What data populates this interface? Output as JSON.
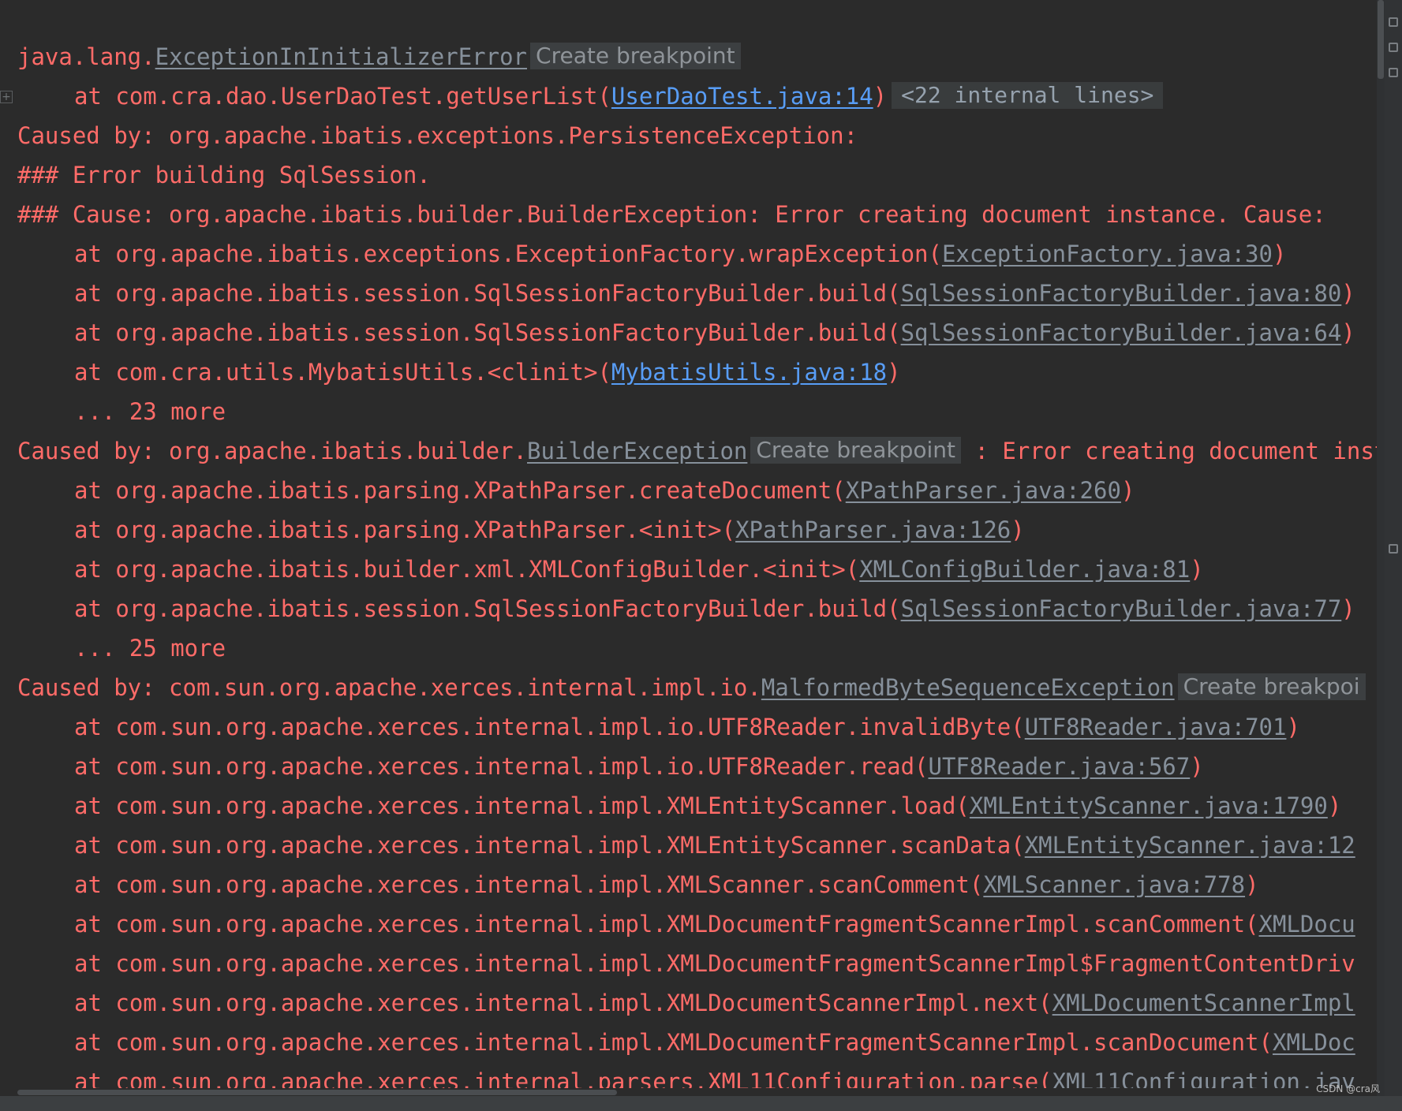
{
  "console": {
    "lines": [
      {
        "indent": false,
        "parts": [
          {
            "text": "java.lang.",
            "style": "t"
          },
          {
            "text": "ExceptionInInitializerError",
            "style": "link-gray"
          },
          {
            "text": "Create breakpoint",
            "style": "chip"
          }
        ]
      },
      {
        "indent": true,
        "parts": [
          {
            "text": "at com.cra.dao.UserDaoTest.getUserList(",
            "style": "t"
          },
          {
            "text": "UserDaoTest.java:14",
            "style": "link-blue"
          },
          {
            "text": ")",
            "style": "t"
          },
          {
            "text": "<22 internal lines>",
            "style": "chip mono"
          }
        ]
      },
      {
        "indent": false,
        "parts": [
          {
            "text": "Caused by: org.apache.ibatis.exceptions.PersistenceException:",
            "style": "t"
          }
        ]
      },
      {
        "indent": false,
        "parts": [
          {
            "text": "### Error building SqlSession.",
            "style": "t"
          }
        ]
      },
      {
        "indent": false,
        "parts": [
          {
            "text": "### Cause: org.apache.ibatis.builder.BuilderException: Error creating document instance.  Cause:",
            "style": "t"
          }
        ]
      },
      {
        "indent": true,
        "parts": [
          {
            "text": "at org.apache.ibatis.exceptions.ExceptionFactory.wrapException(",
            "style": "t"
          },
          {
            "text": "ExceptionFactory.java:30",
            "style": "link-gray"
          },
          {
            "text": ")",
            "style": "t"
          }
        ]
      },
      {
        "indent": true,
        "parts": [
          {
            "text": "at org.apache.ibatis.session.SqlSessionFactoryBuilder.build(",
            "style": "t"
          },
          {
            "text": "SqlSessionFactoryBuilder.java:80",
            "style": "link-gray"
          },
          {
            "text": ")",
            "style": "t"
          }
        ]
      },
      {
        "indent": true,
        "parts": [
          {
            "text": "at org.apache.ibatis.session.SqlSessionFactoryBuilder.build(",
            "style": "t"
          },
          {
            "text": "SqlSessionFactoryBuilder.java:64",
            "style": "link-gray"
          },
          {
            "text": ")",
            "style": "t"
          }
        ]
      },
      {
        "indent": true,
        "parts": [
          {
            "text": "at com.cra.utils.MybatisUtils.<clinit>(",
            "style": "t"
          },
          {
            "text": "MybatisUtils.java:18",
            "style": "link-blue"
          },
          {
            "text": ")",
            "style": "t"
          }
        ]
      },
      {
        "indent": true,
        "parts": [
          {
            "text": "... 23 more",
            "style": "t"
          }
        ]
      },
      {
        "indent": false,
        "parts": [
          {
            "text": "Caused by: org.apache.ibatis.builder.",
            "style": "t"
          },
          {
            "text": "BuilderException",
            "style": "link-gray"
          },
          {
            "text": "Create breakpoint",
            "style": "chip"
          },
          {
            "text": " : Error creating document inst",
            "style": "t"
          }
        ]
      },
      {
        "indent": true,
        "parts": [
          {
            "text": "at org.apache.ibatis.parsing.XPathParser.createDocument(",
            "style": "t"
          },
          {
            "text": "XPathParser.java:260",
            "style": "link-gray"
          },
          {
            "text": ")",
            "style": "t"
          }
        ]
      },
      {
        "indent": true,
        "parts": [
          {
            "text": "at org.apache.ibatis.parsing.XPathParser.<init>(",
            "style": "t"
          },
          {
            "text": "XPathParser.java:126",
            "style": "link-gray"
          },
          {
            "text": ")",
            "style": "t"
          }
        ]
      },
      {
        "indent": true,
        "parts": [
          {
            "text": "at org.apache.ibatis.builder.xml.XMLConfigBuilder.<init>(",
            "style": "t"
          },
          {
            "text": "XMLConfigBuilder.java:81",
            "style": "link-gray"
          },
          {
            "text": ")",
            "style": "t"
          }
        ]
      },
      {
        "indent": true,
        "parts": [
          {
            "text": "at org.apache.ibatis.session.SqlSessionFactoryBuilder.build(",
            "style": "t"
          },
          {
            "text": "SqlSessionFactoryBuilder.java:77",
            "style": "link-gray"
          },
          {
            "text": ")",
            "style": "t"
          }
        ]
      },
      {
        "indent": true,
        "parts": [
          {
            "text": "... 25 more",
            "style": "t"
          }
        ]
      },
      {
        "indent": false,
        "parts": [
          {
            "text": "Caused by: com.sun.org.apache.xerces.internal.impl.io.",
            "style": "t"
          },
          {
            "text": "MalformedByteSequenceException",
            "style": "link-gray"
          },
          {
            "text": "Create breakpoi",
            "style": "chip"
          }
        ]
      },
      {
        "indent": true,
        "parts": [
          {
            "text": "at com.sun.org.apache.xerces.internal.impl.io.UTF8Reader.invalidByte(",
            "style": "t"
          },
          {
            "text": "UTF8Reader.java:701",
            "style": "link-gray"
          },
          {
            "text": ")",
            "style": "t"
          }
        ]
      },
      {
        "indent": true,
        "parts": [
          {
            "text": "at com.sun.org.apache.xerces.internal.impl.io.UTF8Reader.read(",
            "style": "t"
          },
          {
            "text": "UTF8Reader.java:567",
            "style": "link-gray"
          },
          {
            "text": ")",
            "style": "t"
          }
        ]
      },
      {
        "indent": true,
        "parts": [
          {
            "text": "at com.sun.org.apache.xerces.internal.impl.XMLEntityScanner.load(",
            "style": "t"
          },
          {
            "text": "XMLEntityScanner.java:1790",
            "style": "link-gray"
          },
          {
            "text": ")",
            "style": "t"
          }
        ]
      },
      {
        "indent": true,
        "parts": [
          {
            "text": "at com.sun.org.apache.xerces.internal.impl.XMLEntityScanner.scanData(",
            "style": "t"
          },
          {
            "text": "XMLEntityScanner.java:12",
            "style": "link-gray"
          }
        ]
      },
      {
        "indent": true,
        "parts": [
          {
            "text": "at com.sun.org.apache.xerces.internal.impl.XMLScanner.scanComment(",
            "style": "t"
          },
          {
            "text": "XMLScanner.java:778",
            "style": "link-gray"
          },
          {
            "text": ")",
            "style": "t"
          }
        ]
      },
      {
        "indent": true,
        "parts": [
          {
            "text": "at com.sun.org.apache.xerces.internal.impl.XMLDocumentFragmentScannerImpl.scanComment(",
            "style": "t"
          },
          {
            "text": "XMLDocu",
            "style": "link-gray"
          }
        ]
      },
      {
        "indent": true,
        "parts": [
          {
            "text": "at com.sun.org.apache.xerces.internal.impl.XMLDocumentFragmentScannerImpl$FragmentContentDriv",
            "style": "t"
          }
        ]
      },
      {
        "indent": true,
        "parts": [
          {
            "text": "at com.sun.org.apache.xerces.internal.impl.XMLDocumentScannerImpl.next(",
            "style": "t"
          },
          {
            "text": "XMLDocumentScannerImpl",
            "style": "link-gray"
          }
        ]
      },
      {
        "indent": true,
        "parts": [
          {
            "text": "at com.sun.org.apache.xerces.internal.impl.XMLDocumentFragmentScannerImpl.scanDocument(",
            "style": "t"
          },
          {
            "text": "XMLDoc",
            "style": "link-gray"
          }
        ]
      },
      {
        "indent": true,
        "parts": [
          {
            "text": "at com.sun.org.apache.xerces.internal.parsers.XML11Configuration.parse(",
            "style": "t"
          },
          {
            "text": "XML11Configuration.jav",
            "style": "link-gray"
          }
        ]
      }
    ]
  },
  "icons": {
    "expand": "+",
    "expand_name": "expand-fold-icon"
  },
  "watermark": "CSDN @cra风",
  "colors": {
    "background": "#2b2b2b",
    "error_text": "#ff6b68",
    "link_blue": "#589df6",
    "link_gray": "#a9b7c6",
    "chip_bg": "#3c3f41"
  }
}
